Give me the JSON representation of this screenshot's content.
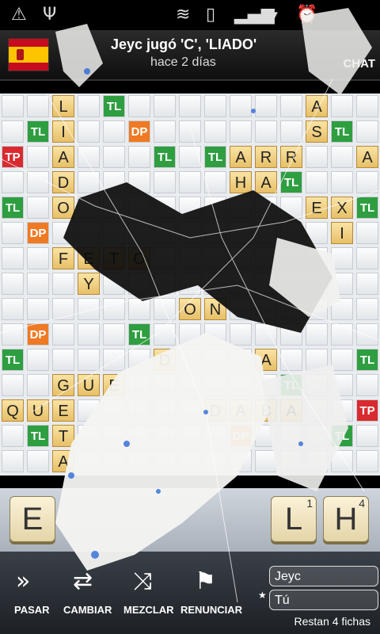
{
  "status_bar": {
    "icons": [
      "warning-icon",
      "usb-icon",
      "wifi-icon",
      "vibrate-icon",
      "signal-icon",
      "battery-charging-icon",
      "alarm-icon"
    ],
    "time": ""
  },
  "header": {
    "flag": "spain-flag",
    "title": "Jeyc jugó 'C', 'LIADO'",
    "subtitle": "hace 2 días",
    "chat_label": "CHAT"
  },
  "board": {
    "premium_labels": {
      "tl": "TL",
      "dp": "DP",
      "tp": "TP"
    },
    "premium_squares": [
      {
        "type": "tl",
        "r": 0,
        "c": 4
      },
      {
        "type": "tl",
        "r": 1,
        "c": 1
      },
      {
        "type": "dp",
        "r": 1,
        "c": 5
      },
      {
        "type": "tl",
        "r": 1,
        "c": 13
      },
      {
        "type": "tp",
        "r": 2,
        "c": 0
      },
      {
        "type": "tl",
        "r": 2,
        "c": 6
      },
      {
        "type": "tl",
        "r": 2,
        "c": 8
      },
      {
        "type": "tl",
        "r": 3,
        "c": 11
      },
      {
        "type": "tl",
        "r": 4,
        "c": 0
      },
      {
        "type": "tl",
        "r": 4,
        "c": 14
      },
      {
        "type": "dp",
        "r": 5,
        "c": 1
      },
      {
        "type": "dp",
        "r": 9,
        "c": 1
      },
      {
        "type": "tl",
        "r": 9,
        "c": 5
      },
      {
        "type": "tl",
        "r": 10,
        "c": 0
      },
      {
        "type": "tl",
        "r": 10,
        "c": 14
      },
      {
        "type": "tl",
        "r": 11,
        "c": 11
      },
      {
        "type": "tp",
        "r": 12,
        "c": 14
      },
      {
        "type": "tl",
        "r": 13,
        "c": 1
      },
      {
        "type": "dp",
        "r": 13,
        "c": 9
      },
      {
        "type": "tl",
        "r": 13,
        "c": 13
      }
    ],
    "tiles": [
      {
        "letter": "L",
        "r": 0,
        "c": 2
      },
      {
        "letter": "A",
        "r": 0,
        "c": 12
      },
      {
        "letter": "I",
        "r": 1,
        "c": 2
      },
      {
        "letter": "S",
        "r": 1,
        "c": 12
      },
      {
        "letter": "A",
        "r": 2,
        "c": 2
      },
      {
        "letter": "A",
        "r": 2,
        "c": 9
      },
      {
        "letter": "R",
        "r": 2,
        "c": 10
      },
      {
        "letter": "R",
        "r": 2,
        "c": 11
      },
      {
        "letter": "A",
        "r": 2,
        "c": 14
      },
      {
        "letter": "D",
        "r": 3,
        "c": 2
      },
      {
        "letter": "H",
        "r": 3,
        "c": 9
      },
      {
        "letter": "A",
        "r": 3,
        "c": 10
      },
      {
        "letter": "O",
        "r": 4,
        "c": 2
      },
      {
        "letter": "E",
        "r": 4,
        "c": 12
      },
      {
        "letter": "X",
        "r": 4,
        "c": 13
      },
      {
        "letter": "I",
        "r": 5,
        "c": 13
      },
      {
        "letter": "F",
        "r": 6,
        "c": 2
      },
      {
        "letter": "E",
        "r": 6,
        "c": 3
      },
      {
        "letter": "T",
        "r": 6,
        "c": 4
      },
      {
        "letter": "O",
        "r": 6,
        "c": 5
      },
      {
        "letter": "Y",
        "r": 7,
        "c": 3
      },
      {
        "letter": "O",
        "r": 8,
        "c": 7
      },
      {
        "letter": "N",
        "r": 8,
        "c": 8
      },
      {
        "letter": "D",
        "r": 10,
        "c": 6
      },
      {
        "letter": "A",
        "r": 10,
        "c": 10
      },
      {
        "letter": "G",
        "r": 11,
        "c": 2
      },
      {
        "letter": "U",
        "r": 11,
        "c": 3
      },
      {
        "letter": "E",
        "r": 11,
        "c": 4
      },
      {
        "letter": "Q",
        "r": 12,
        "c": 0
      },
      {
        "letter": "U",
        "r": 12,
        "c": 1
      },
      {
        "letter": "E",
        "r": 12,
        "c": 2
      },
      {
        "letter": "D",
        "r": 12,
        "c": 8
      },
      {
        "letter": "A",
        "r": 12,
        "c": 9
      },
      {
        "letter": "B",
        "r": 12,
        "c": 10
      },
      {
        "letter": "A",
        "r": 12,
        "c": 11
      },
      {
        "letter": "T",
        "r": 13,
        "c": 2
      },
      {
        "letter": "A",
        "r": 14,
        "c": 2
      }
    ]
  },
  "rack": {
    "tiles": [
      {
        "letter": "E",
        "points": "",
        "slot": 0
      },
      {
        "letter": "L",
        "points": "1",
        "slot": 5
      },
      {
        "letter": "H",
        "points": "4",
        "slot": 6
      }
    ]
  },
  "bottom_bar": {
    "pass_label": "PASAR",
    "swap_label": "CAMBIAR",
    "shuffle_label": "MEZCLAR",
    "resign_label": "RENUNCIAR",
    "player1": "Jeyc",
    "player2": "Tú",
    "remaining": "Restan 4 fichas"
  }
}
